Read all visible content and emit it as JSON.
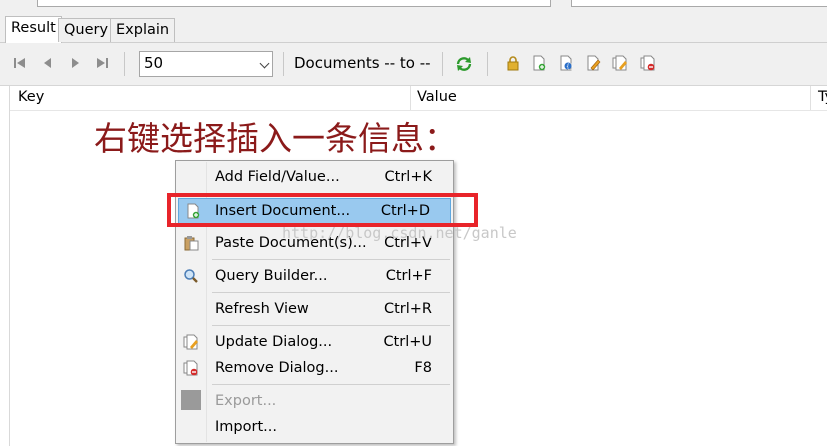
{
  "tabs": [
    "Result",
    "Query",
    "Explain"
  ],
  "toolbar": {
    "page_size": "50",
    "documents_label": "Documents -- to --"
  },
  "columns": [
    "Key",
    "Value",
    "Ty"
  ],
  "annotation": "右键选择插入一条信息：",
  "watermark": "http://blog.csdn.net/ganle",
  "context_menu": {
    "items": [
      {
        "label": "Add Field/Value...",
        "shortcut": "Ctrl+K"
      },
      {
        "label": "Insert Document...",
        "shortcut": "Ctrl+D",
        "selected": true
      },
      {
        "label": "Paste Document(s)...",
        "shortcut": "Ctrl+V"
      },
      {
        "label": "Query Builder...",
        "shortcut": "Ctrl+F"
      },
      {
        "label": "Refresh View",
        "shortcut": "Ctrl+R"
      },
      {
        "label": "Update Dialog...",
        "shortcut": "Ctrl+U"
      },
      {
        "label": "Remove Dialog...",
        "shortcut": "F8"
      },
      {
        "label": "Export...",
        "shortcut": "",
        "disabled": true
      },
      {
        "label": "Import...",
        "shortcut": ""
      }
    ]
  },
  "colors": {
    "highlight": "#99c9ef",
    "annotation": "#8b1a1a",
    "callout_box": "#e8242a"
  }
}
